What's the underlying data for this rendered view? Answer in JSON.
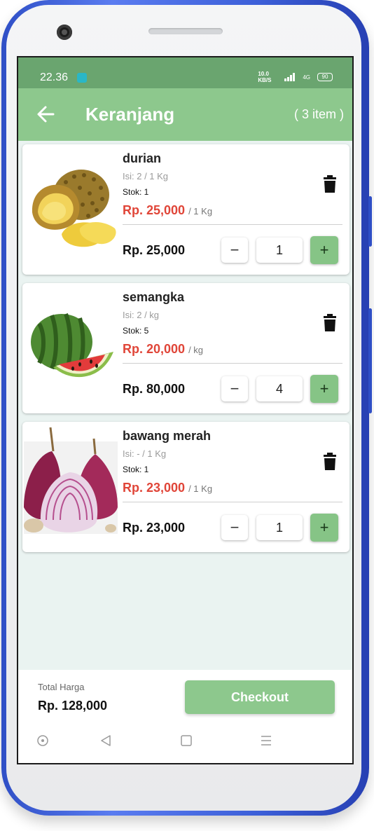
{
  "status": {
    "time": "22.36",
    "network_speed": "10.0 KB/S",
    "signal_label": "4G",
    "battery": "90"
  },
  "header": {
    "title": "Keranjang",
    "item_count": "( 3 item )"
  },
  "cart": [
    {
      "name": "durian",
      "isi": "Isi: 2 / 1 Kg",
      "stok": "Stok: 1",
      "price": "Rp. 25,000",
      "unit": "/ 1 Kg",
      "subtotal": "Rp. 25,000",
      "qty": "1",
      "minus": "−",
      "plus": "+",
      "image": "durian-image"
    },
    {
      "name": "semangka",
      "isi": "Isi: 2 / kg",
      "stok": "Stok: 5",
      "price": "Rp. 20,000",
      "unit": "/ kg",
      "subtotal": "Rp. 80,000",
      "qty": "4",
      "minus": "−",
      "plus": "+",
      "image": "watermelon-image"
    },
    {
      "name": "bawang merah",
      "isi": "Isi: - / 1 Kg",
      "stok": "Stok: 1",
      "price": "Rp. 23,000",
      "unit": "/ 1 Kg",
      "subtotal": "Rp. 23,000",
      "qty": "1",
      "minus": "−",
      "plus": "+",
      "image": "red-onion-image"
    }
  ],
  "footer": {
    "total_label": "Total Harga",
    "total_value": "Rp. 128,000",
    "checkout_label": "Checkout"
  },
  "colors": {
    "appbar": "#8dc88d",
    "statusbar": "#6aa56f",
    "price": "#e04538",
    "plus_button": "#86c486",
    "frame": "#3c5fd8"
  },
  "icons": {
    "back": "arrow-left-icon",
    "delete": "trash-icon",
    "nav": [
      "circle-icon",
      "triangle-back-icon",
      "square-icon",
      "menu-lines-icon"
    ]
  }
}
